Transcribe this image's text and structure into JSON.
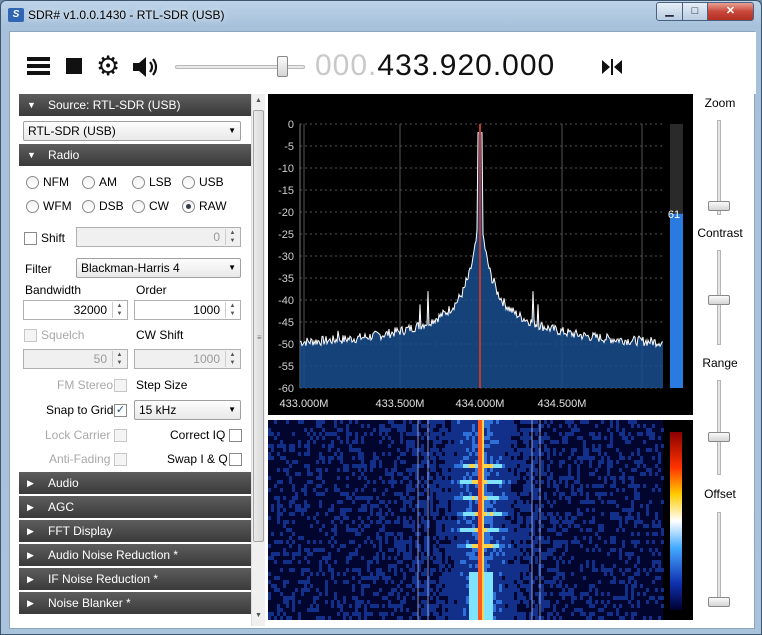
{
  "window": {
    "title": "SDR# v1.0.0.1430 - RTL-SDR (USB)",
    "min_glyph": "▁",
    "max_glyph": "□",
    "close_glyph": "✕",
    "icon_letter": "S"
  },
  "toolbar": {
    "freq_dim": "000.",
    "freq_main": "433.920.000",
    "menu_icon": "hamburger-icon",
    "stop_icon": "stop-icon",
    "settings_icon": "gear-icon",
    "audio_icon": "speaker-icon",
    "swap_icon": "swap-icon",
    "gear_glyph": "⚙"
  },
  "sidebar": {
    "source_header": "Source: RTL-SDR (USB)",
    "source_device": "RTL-SDR (USB)",
    "radio_header": "Radio",
    "modes": [
      {
        "label": "NFM",
        "selected": false
      },
      {
        "label": "AM",
        "selected": false
      },
      {
        "label": "LSB",
        "selected": false
      },
      {
        "label": "USB",
        "selected": false
      },
      {
        "label": "WFM",
        "selected": false
      },
      {
        "label": "DSB",
        "selected": false
      },
      {
        "label": "CW",
        "selected": false
      },
      {
        "label": "RAW",
        "selected": true
      }
    ],
    "shift_label": "Shift",
    "shift_value": "0",
    "filter_label": "Filter",
    "filter_value": "Blackman-Harris 4",
    "bandwidth_label": "Bandwidth",
    "bandwidth_value": "32000",
    "order_label": "Order",
    "order_value": "1000",
    "squelch_label": "Squelch",
    "cw_shift_label": "CW Shift",
    "squelch_value": "50",
    "cw_shift_value": "1000",
    "fm_stereo_label": "FM Stereo",
    "step_size_label": "Step Size",
    "snap_to_grid_label": "Snap to Grid",
    "snap_to_grid_checked": "✓",
    "step_size_value": "15 kHz",
    "lock_carrier_label": "Lock Carrier",
    "correct_iq_label": "Correct IQ",
    "anti_fading_label": "Anti-Fading",
    "swap_iq_label": "Swap I & Q",
    "collapsed_sections": [
      "Audio",
      "AGC",
      "FFT Display",
      "Audio Noise Reduction *",
      "IF Noise Reduction *",
      "Noise Blanker *"
    ],
    "expanded_arrow": "▼",
    "collapsed_arrow": "▶"
  },
  "spectrum": {
    "y_ticks": [
      "0",
      "-5",
      "-10",
      "-15",
      "-20",
      "-25",
      "-30",
      "-35",
      "-40",
      "-45",
      "-50",
      "-55",
      "-60"
    ],
    "x_ticks": [
      "433.000M",
      "433.500M",
      "434.000M",
      "434.500M"
    ],
    "level_value": "61",
    "level_fraction": 0.66
  },
  "right_panel": {
    "zoom_label": "Zoom",
    "contrast_label": "Contrast",
    "range_label": "Range",
    "offset_label": "Offset"
  },
  "colors": {
    "section_header": "#454545",
    "spectrum_fill": "#1a4d8f",
    "level_bar": "#2a7be0",
    "tuning_marker": "#c0392b"
  }
}
